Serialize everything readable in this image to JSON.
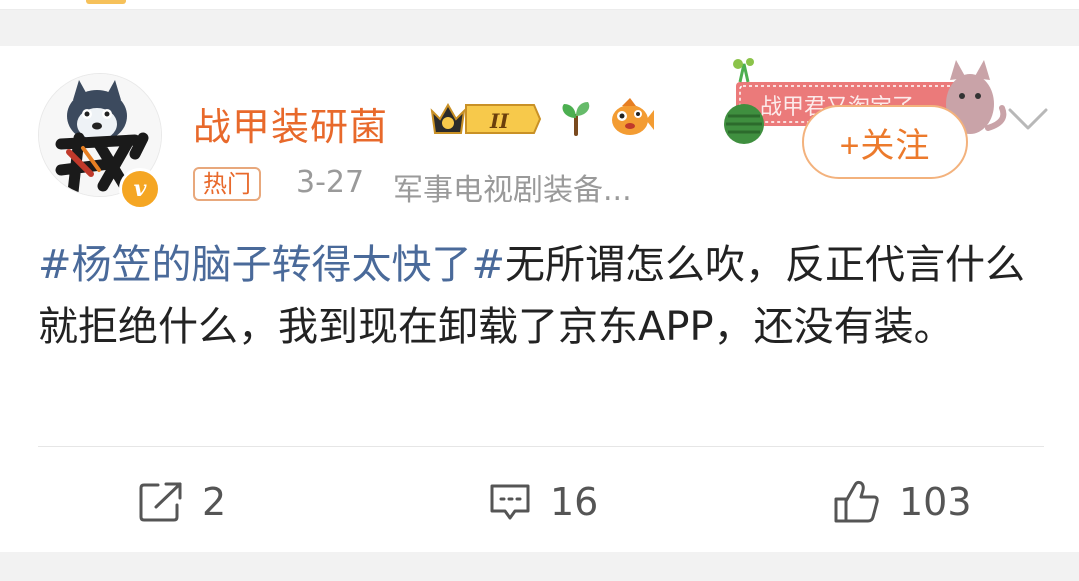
{
  "post": {
    "author": {
      "name": "战甲装研菌",
      "level_badge": "II",
      "verified_mark": "v",
      "avatar_text": "我"
    },
    "hot_tag": "热门",
    "date": "3-27",
    "source": "军事电视剧装备...",
    "follow_button_label": "+关注",
    "decoration_text": "战甲君又淘宝了",
    "text": {
      "hashtag": "#杨笠的脑子转得太快了#",
      "body": "无所谓怎么吹，反正代言什么就拒绝什么，我到现在卸载了京东APP，还没有装。"
    },
    "actions": {
      "repost_count": "2",
      "comment_count": "16",
      "like_count": "103"
    }
  },
  "icons": {
    "repost": "share-icon",
    "comment": "comment-icon",
    "like": "thumbs-up-icon",
    "more": "chevron-down-icon"
  },
  "colors": {
    "username": "#e8692b",
    "hashtag": "#4a6a9a",
    "follow_border": "#f3b27d",
    "meta": "#9a9a9a"
  }
}
